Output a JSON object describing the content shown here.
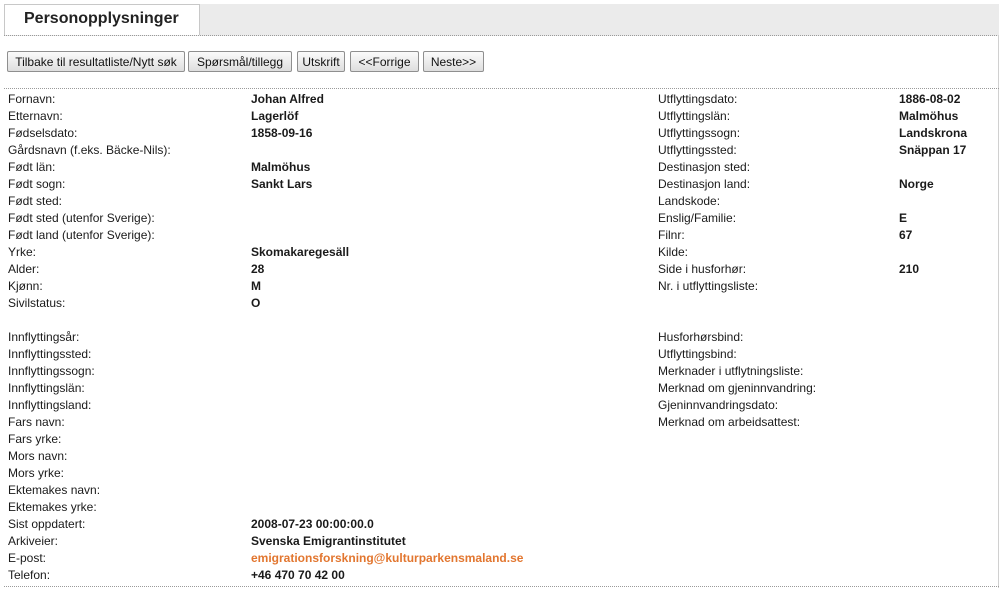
{
  "tab": {
    "title": "Personopplysninger"
  },
  "toolbar": {
    "back": "Tilbake til resultatliste/Nytt søk",
    "question": "Spørsmål/tillegg",
    "print": "Utskrift",
    "prev": "<<Forrige",
    "next": "Neste>>"
  },
  "left_fields": [
    {
      "label": "Fornavn:",
      "value": "Johan Alfred"
    },
    {
      "label": "Etternavn:",
      "value": "Lagerlöf"
    },
    {
      "label": "Fødselsdato:",
      "value": "1858-09-16"
    },
    {
      "label": "Gårdsnavn (f.eks. Bäcke-Nils):",
      "value": ""
    },
    {
      "label": "Født län:",
      "value": "Malmöhus"
    },
    {
      "label": "Født sogn:",
      "value": "Sankt Lars"
    },
    {
      "label": "Født sted:",
      "value": ""
    },
    {
      "label": "Født sted (utenfor Sverige):",
      "value": ""
    },
    {
      "label": "Født land (utenfor Sverige):",
      "value": ""
    },
    {
      "label": "Yrke:",
      "value": "Skomakaregesäll"
    },
    {
      "label": "Alder:",
      "value": "28"
    },
    {
      "label": "Kjønn:",
      "value": "M"
    },
    {
      "label": "Sivilstatus:",
      "value": "O"
    }
  ],
  "left_fields2": [
    {
      "label": "Innflyttingsår:",
      "value": ""
    },
    {
      "label": "Innflyttingssted:",
      "value": ""
    },
    {
      "label": "Innflyttingssogn:",
      "value": ""
    },
    {
      "label": "Innflyttingslän:",
      "value": ""
    },
    {
      "label": "Innflyttingsland:",
      "value": ""
    },
    {
      "label": "Fars navn:",
      "value": ""
    },
    {
      "label": "Fars yrke:",
      "value": ""
    },
    {
      "label": "Mors navn:",
      "value": ""
    },
    {
      "label": "Mors yrke:",
      "value": ""
    },
    {
      "label": "Ektemakes navn:",
      "value": ""
    },
    {
      "label": "Ektemakes yrke:",
      "value": ""
    },
    {
      "label": "Sist oppdatert:",
      "value": "2008-07-23 00:00:00.0"
    },
    {
      "label": "Arkiveier:",
      "value": "Svenska Emigrantinstitutet"
    },
    {
      "label": "E-post:",
      "value": "emigrationsforskning@kulturparkensmaland.se"
    },
    {
      "label": "Telefon:",
      "value": "+46 470 70 42 00"
    }
  ],
  "right_fields": [
    {
      "label": "Utflyttingsdato:",
      "value": "1886-08-02"
    },
    {
      "label": "Utflyttingslän:",
      "value": "Malmöhus"
    },
    {
      "label": "Utflyttingssogn:",
      "value": "Landskrona"
    },
    {
      "label": "Utflyttingssted:",
      "value": "Snäppan 17"
    },
    {
      "label": "Destinasjon sted:",
      "value": ""
    },
    {
      "label": "Destinasjon land:",
      "value": "Norge"
    },
    {
      "label": "Landskode:",
      "value": ""
    },
    {
      "label": "Enslig/Familie:",
      "value": "E"
    },
    {
      "label": "Filnr:",
      "value": "67"
    },
    {
      "label": "Kilde:",
      "value": ""
    },
    {
      "label": "Side i husforhør:",
      "value": "210"
    },
    {
      "label": "Nr. i utflyttingsliste:",
      "value": ""
    }
  ],
  "right_fields2": [
    {
      "label": "Husforhørsbind:",
      "value": ""
    },
    {
      "label": "Utflyttingsbind:",
      "value": ""
    },
    {
      "label": "Merknader i utflytningsliste:",
      "value": ""
    },
    {
      "label": "Merknad om gjeninnvandring:",
      "value": ""
    },
    {
      "label": "Gjeninnvandringsdato:",
      "value": ""
    },
    {
      "label": "Merknad om arbeidsattest:",
      "value": ""
    }
  ],
  "colors": {
    "email": "#e2762f",
    "tabbar": "#ebebeb"
  }
}
